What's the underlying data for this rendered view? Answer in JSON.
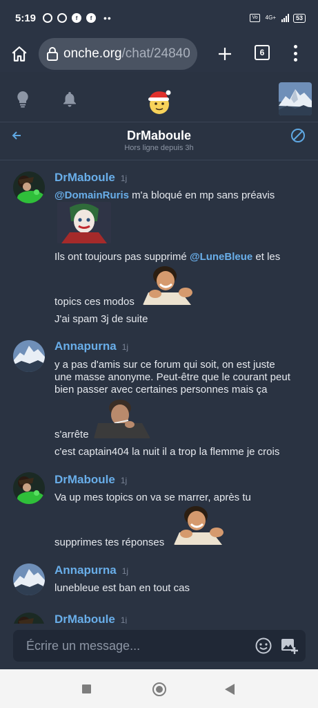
{
  "status_bar": {
    "time": "5:19",
    "network": "4G+",
    "battery": "53"
  },
  "browser": {
    "url_host": "onche.org",
    "url_path": "/chat/24840",
    "tab_count": "6"
  },
  "chat": {
    "title": "DrMaboule",
    "subtitle": "Hors ligne depuis 3h"
  },
  "messages": [
    {
      "author": "DrMaboule",
      "ago": "1j",
      "lines": [
        {
          "mention": "@DomainRuris",
          "text": " m'a bloqué en mp sans préavis"
        },
        {
          "text": "Ils ont toujours pas supprimé ",
          "mention": "@LuneBleue",
          "after": " et les"
        },
        {
          "text": "topics ces modos"
        },
        {
          "text": "J'ai spam 3j de suite"
        }
      ]
    },
    {
      "author": "Annapurna",
      "ago": "1j",
      "lines": [
        {
          "text": "y a pas d'amis sur ce forum qui soit, on est juste"
        },
        {
          "text": "une masse anonyme. Peut-être que le courant peut"
        },
        {
          "text": "bien passer avec certaines personnes mais ça"
        },
        {
          "text": "s'arrête"
        },
        {
          "text": "c'est captain404 la nuit il a trop la flemme je crois"
        }
      ]
    },
    {
      "author": "DrMaboule",
      "ago": "1j",
      "lines": [
        {
          "text": "Va up mes topics on va se marrer, après tu"
        },
        {
          "text": "supprimes tes réponses"
        }
      ]
    },
    {
      "author": "Annapurna",
      "ago": "1j",
      "lines": [
        {
          "text": "lunebleue est ban en tout cas"
        }
      ]
    },
    {
      "author": "DrMaboule",
      "ago": "1j",
      "lines": []
    }
  ],
  "composer": {
    "placeholder": "Écrire un message..."
  },
  "icons": {
    "home": "home-icon",
    "lock": "lock-icon",
    "plus": "plus-icon",
    "menu": "more-vert-icon",
    "bulb": "lightbulb-icon",
    "bell": "bell-icon",
    "back": "arrow-left-icon",
    "block": "block-icon",
    "emoji": "emoji-icon",
    "image": "add-image-icon"
  },
  "colors": {
    "background": "#2a3342",
    "accent": "#69aee9",
    "input_bg": "#202836"
  }
}
